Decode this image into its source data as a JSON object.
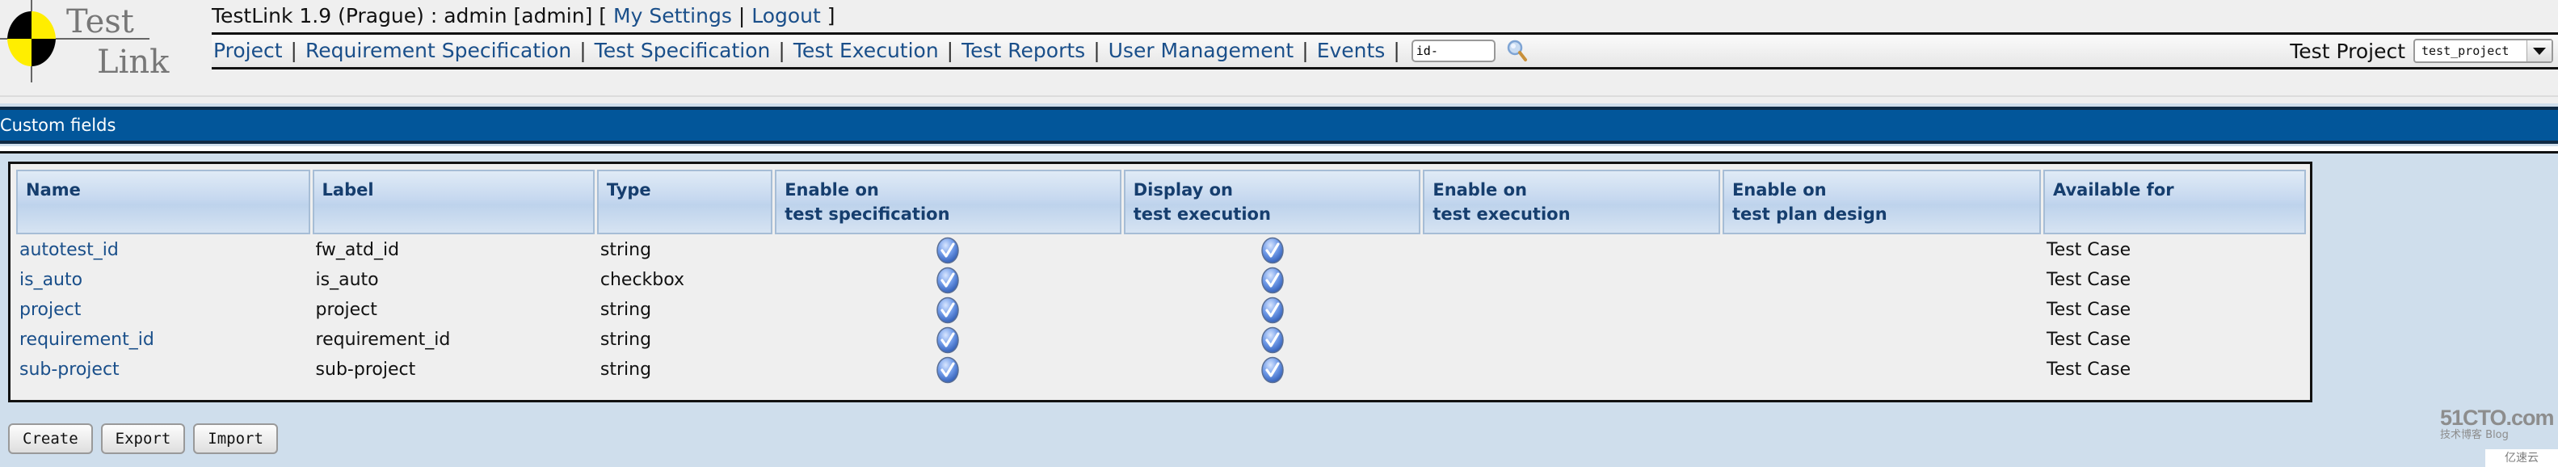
{
  "header": {
    "logo_text_top": "Test",
    "logo_text_bottom": "Link",
    "app_title": "TestLink 1.9 (Prague) : admin [admin]",
    "bracket_open": " [ ",
    "my_settings": "My Settings",
    "link_sep": " | ",
    "logout": "Logout",
    "bracket_close": " ]"
  },
  "nav": {
    "items": [
      {
        "label": "Project"
      },
      {
        "label": "Requirement Specification"
      },
      {
        "label": "Test Specification"
      },
      {
        "label": "Test Execution"
      },
      {
        "label": "Test Reports"
      },
      {
        "label": "User Management"
      },
      {
        "label": "Events"
      }
    ],
    "separator": "|",
    "search_value": "id-",
    "search_icon": "magnifier-icon",
    "test_project_label": "Test Project",
    "test_project_selected": "test_project"
  },
  "page": {
    "title": "Custom fields"
  },
  "table": {
    "columns": [
      {
        "line1": "Name",
        "line2": ""
      },
      {
        "line1": "Label",
        "line2": ""
      },
      {
        "line1": "Type",
        "line2": ""
      },
      {
        "line1": "Enable on",
        "line2": "test specification"
      },
      {
        "line1": "Display on",
        "line2": "test execution"
      },
      {
        "line1": "Enable on",
        "line2": "test execution"
      },
      {
        "line1": "Enable on",
        "line2": "test plan design"
      },
      {
        "line1": "Available for",
        "line2": ""
      }
    ],
    "rows": [
      {
        "name": "autotest_id",
        "label": "fw_atd_id",
        "type": "string",
        "enable_spec": true,
        "display_exec": true,
        "enable_exec": false,
        "enable_plan": false,
        "available_for": "Test Case"
      },
      {
        "name": "is_auto",
        "label": "is_auto",
        "type": "checkbox",
        "enable_spec": true,
        "display_exec": true,
        "enable_exec": false,
        "enable_plan": false,
        "available_for": "Test Case"
      },
      {
        "name": "project",
        "label": "project",
        "type": "string",
        "enable_spec": true,
        "display_exec": true,
        "enable_exec": false,
        "enable_plan": false,
        "available_for": "Test Case"
      },
      {
        "name": "requirement_id",
        "label": "requirement_id",
        "type": "string",
        "enable_spec": true,
        "display_exec": true,
        "enable_exec": false,
        "enable_plan": false,
        "available_for": "Test Case"
      },
      {
        "name": "sub-project",
        "label": "sub-project",
        "type": "string",
        "enable_spec": true,
        "display_exec": true,
        "enable_exec": false,
        "enable_plan": false,
        "available_for": "Test Case"
      }
    ],
    "check_icon": "checkmark-icon"
  },
  "buttons": {
    "create": "Create",
    "export": "Export",
    "import": "Import"
  },
  "watermark": {
    "main": "51CTO.com",
    "sub_cn": "技术博客",
    "sub_en": "Blog",
    "yisu": "亿速云"
  },
  "colors": {
    "title_bar": "#02569a",
    "link": "#1a4f8a",
    "header_text": "#163e6e",
    "page_bg": "#cfdeec"
  }
}
